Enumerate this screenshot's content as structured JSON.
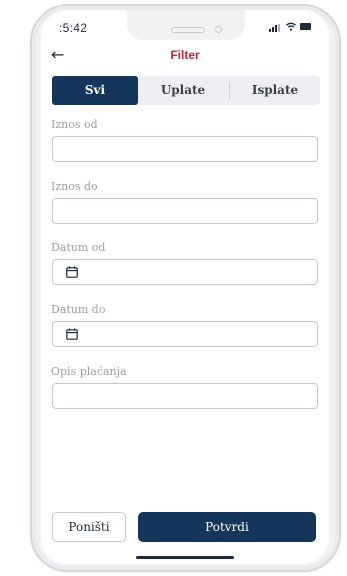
{
  "status_bar": {
    "time": ":5:42"
  },
  "header": {
    "title": "Filter",
    "back_icon": "arrow-left-icon"
  },
  "segments": [
    {
      "label": "Svi",
      "active": true
    },
    {
      "label": "Uplate",
      "active": false
    },
    {
      "label": "Isplate",
      "active": false
    }
  ],
  "fields": {
    "amount_from": {
      "label": "Iznos od",
      "value": ""
    },
    "amount_to": {
      "label": "Iznos do",
      "value": ""
    },
    "date_from": {
      "label": "Datum od",
      "value": "",
      "icon": "calendar-icon"
    },
    "date_to": {
      "label": "Datum do",
      "value": "",
      "icon": "calendar-icon"
    },
    "description": {
      "label": "Opis plaćanja",
      "value": ""
    }
  },
  "actions": {
    "cancel_label": "Poništi",
    "confirm_label": "Potvrdi"
  },
  "colors": {
    "primary": "#15355a",
    "title": "#c0283d",
    "border": "#c5c9ce",
    "label": "#9aa0a8"
  }
}
